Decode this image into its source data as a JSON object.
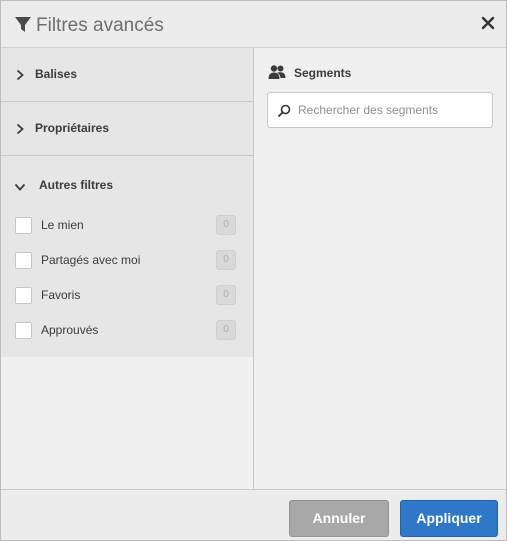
{
  "dialog": {
    "title": "Filtres avancés",
    "title_icon": "filter-icon",
    "close_icon": "close-icon"
  },
  "left_panel": {
    "sections": [
      {
        "label": "Balises",
        "expanded": false
      },
      {
        "label": "Propriétaires",
        "expanded": false
      },
      {
        "label": "Autres filtres",
        "expanded": true
      }
    ],
    "other_filters": [
      {
        "label": "Le mien",
        "count": "0",
        "checked": false
      },
      {
        "label": "Partagés avec moi",
        "count": "0",
        "checked": false
      },
      {
        "label": "Favoris",
        "count": "0",
        "checked": false
      },
      {
        "label": "Approuvés",
        "count": "0",
        "checked": false
      }
    ]
  },
  "right_panel": {
    "segments_label": "Segments",
    "segments_icon": "users-icon",
    "search": {
      "placeholder": "Rechercher des segments",
      "value": ""
    }
  },
  "footer": {
    "cancel_label": "Annuler",
    "apply_label": "Appliquer"
  },
  "colors": {
    "apply": "#2f77c9",
    "cancel": "#a8a8a8",
    "panel": "#e6e6e6"
  }
}
